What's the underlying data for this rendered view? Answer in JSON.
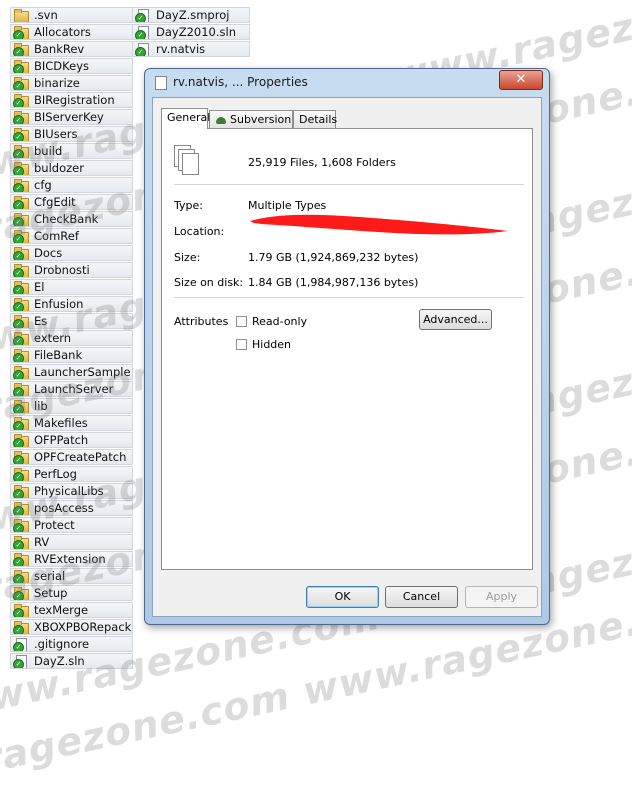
{
  "file_list": {
    "column1": [
      {
        "name": ".svn",
        "kind": "folder",
        "overlay": ""
      },
      {
        "name": "Allocators",
        "kind": "folder",
        "overlay": "check"
      },
      {
        "name": "BankRev",
        "kind": "folder",
        "overlay": "check"
      },
      {
        "name": "BICDKeys",
        "kind": "folder",
        "overlay": "check"
      },
      {
        "name": "binarize",
        "kind": "folder",
        "overlay": "check"
      },
      {
        "name": "BIRegistration",
        "kind": "folder",
        "overlay": "check"
      },
      {
        "name": "BIServerKey",
        "kind": "folder",
        "overlay": "check"
      },
      {
        "name": "BIUsers",
        "kind": "folder",
        "overlay": "check"
      },
      {
        "name": "build",
        "kind": "folder",
        "overlay": "check"
      },
      {
        "name": "buldozer",
        "kind": "folder",
        "overlay": "check"
      },
      {
        "name": "cfg",
        "kind": "folder",
        "overlay": "check"
      },
      {
        "name": "CfgEdit",
        "kind": "folder",
        "overlay": "check"
      },
      {
        "name": "CheckBank",
        "kind": "folder",
        "overlay": "check"
      },
      {
        "name": "ComRef",
        "kind": "folder",
        "overlay": "check"
      },
      {
        "name": "Docs",
        "kind": "folder",
        "overlay": "check"
      },
      {
        "name": "Drobnosti",
        "kind": "folder",
        "overlay": "check"
      },
      {
        "name": "El",
        "kind": "folder",
        "overlay": "check"
      },
      {
        "name": "Enfusion",
        "kind": "folder",
        "overlay": "check"
      },
      {
        "name": "Es",
        "kind": "folder",
        "overlay": "check"
      },
      {
        "name": "extern",
        "kind": "folder",
        "overlay": "check"
      },
      {
        "name": "FileBank",
        "kind": "folder",
        "overlay": "check"
      },
      {
        "name": "LauncherSample",
        "kind": "folder",
        "overlay": "check"
      },
      {
        "name": "LaunchServer",
        "kind": "folder",
        "overlay": "check"
      },
      {
        "name": "lib",
        "kind": "folder",
        "overlay": "check"
      },
      {
        "name": "Makefiles",
        "kind": "folder",
        "overlay": "check"
      },
      {
        "name": "OFPPatch",
        "kind": "folder",
        "overlay": "check"
      },
      {
        "name": "OPFCreatePatch",
        "kind": "folder",
        "overlay": "check"
      },
      {
        "name": "PerfLog",
        "kind": "folder",
        "overlay": "check"
      },
      {
        "name": "PhysicalLibs",
        "kind": "folder",
        "overlay": "check"
      },
      {
        "name": "posAccess",
        "kind": "folder",
        "overlay": "check"
      },
      {
        "name": "Protect",
        "kind": "folder",
        "overlay": "check"
      },
      {
        "name": "RV",
        "kind": "folder",
        "overlay": "check"
      },
      {
        "name": "RVExtension",
        "kind": "folder",
        "overlay": "check"
      },
      {
        "name": "serial",
        "kind": "folder",
        "overlay": "check"
      },
      {
        "name": "Setup",
        "kind": "folder",
        "overlay": "check"
      },
      {
        "name": "texMerge",
        "kind": "folder",
        "overlay": "check"
      },
      {
        "name": "XBOXPBORepack",
        "kind": "folder",
        "overlay": "check"
      },
      {
        "name": ".gitignore",
        "kind": "file",
        "overlay": "check"
      },
      {
        "name": "DayZ.sln",
        "kind": "file",
        "overlay": "check"
      }
    ],
    "column2": [
      {
        "name": "DayZ.smproj",
        "kind": "file",
        "overlay": "check"
      },
      {
        "name": "DayZ2010.sln",
        "kind": "file",
        "overlay": "check"
      },
      {
        "name": "rv.natvis",
        "kind": "file",
        "overlay": "check"
      }
    ]
  },
  "watermark": "www.ragezone.com www.ragezone.com www.ragezone.com",
  "dialog": {
    "title": "rv.natvis, ... Properties",
    "close_glyph": "✕",
    "tabs": [
      {
        "label": "General",
        "active": true
      },
      {
        "label": "Subversion",
        "active": false
      },
      {
        "label": "Details",
        "active": false
      }
    ],
    "summary": "25,919 Files, 1,608 Folders",
    "type_label": "Type:",
    "type_value": "Multiple Types",
    "location_label": "Location:",
    "location_value": "",
    "size_label": "Size:",
    "size_value": "1.79 GB (1,924,869,232 bytes)",
    "size_on_disk_label": "Size on disk:",
    "size_on_disk_value": "1.84 GB (1,984,987,136 bytes)",
    "attributes_label": "Attributes",
    "readonly_label": "Read-only",
    "hidden_label": "Hidden",
    "advanced_label": "Advanced...",
    "ok_label": "OK",
    "cancel_label": "Cancel",
    "apply_label": "Apply",
    "redaction_color": "#ff1a1a"
  }
}
